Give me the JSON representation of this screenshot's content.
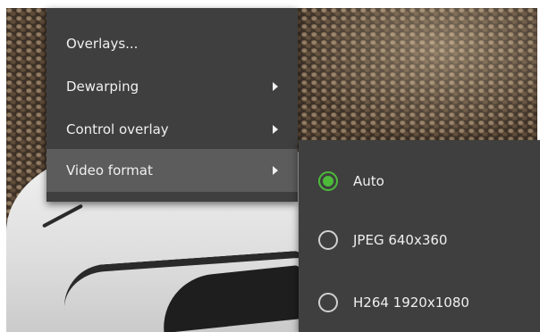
{
  "context_menu": {
    "items": [
      {
        "label": "Overlays...",
        "has_submenu": false
      },
      {
        "label": "Dewarping",
        "has_submenu": true
      },
      {
        "label": "Control overlay",
        "has_submenu": true
      },
      {
        "label": "Video format",
        "has_submenu": true,
        "highlighted": true
      }
    ]
  },
  "video_format_submenu": {
    "options": [
      {
        "label": "Auto",
        "selected": true
      },
      {
        "label": "JPEG 640x360",
        "selected": false
      },
      {
        "label": "H264 1920x1080",
        "selected": false
      }
    ],
    "accent_color": "#4cbb3a"
  },
  "icons": [
    "chevron-right-icon",
    "radio-button-icon"
  ]
}
